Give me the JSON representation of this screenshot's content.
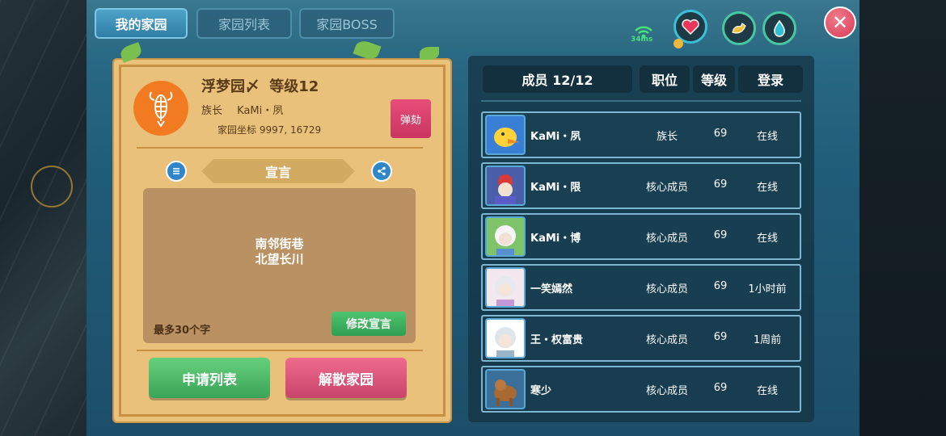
{
  "tabs": [
    {
      "label": "我的家园"
    },
    {
      "label": "家园列表"
    },
    {
      "label": "家园BOSS"
    }
  ],
  "status": {
    "ping": "34ms"
  },
  "guild": {
    "name": "浮梦园〆",
    "level_label": "等级12",
    "leader_role": "族长",
    "leader_name": "KaMi・夙",
    "coords": "家园坐标 9997, 16729",
    "impeach_label": "弹劾",
    "notice_title": "宣言",
    "notice_line1": "南邻街巷",
    "notice_line2": "北望长川",
    "max_hint": "最多30个字",
    "edit_label": "修改宣言",
    "apply_label": "申请列表",
    "disband_label": "解散家园",
    "emblem_icon": "lobster-icon"
  },
  "members_header": {
    "count": "成员 12/12",
    "role": "职位",
    "level": "等级",
    "login": "登录"
  },
  "members": [
    {
      "name": "KaMi・夙",
      "role": "族长",
      "level": "69",
      "login": "在线"
    },
    {
      "name": "KaMi・限",
      "role": "核心成员",
      "level": "69",
      "login": "在线"
    },
    {
      "name": "KaMi・博",
      "role": "核心成员",
      "level": "69",
      "login": "在线"
    },
    {
      "name": "一笑嫣然",
      "role": "核心成员",
      "level": "69",
      "login": "1小时前"
    },
    {
      "name": "王・权富贵",
      "role": "核心成员",
      "level": "69",
      "login": "1周前"
    },
    {
      "name": "寒少",
      "role": "核心成员",
      "level": "69",
      "login": "在线"
    }
  ],
  "colors": {
    "accent": "#2f7ea6",
    "card": "#e9c17b",
    "green_button": "#3aa458",
    "pink_button": "#c8436a"
  }
}
